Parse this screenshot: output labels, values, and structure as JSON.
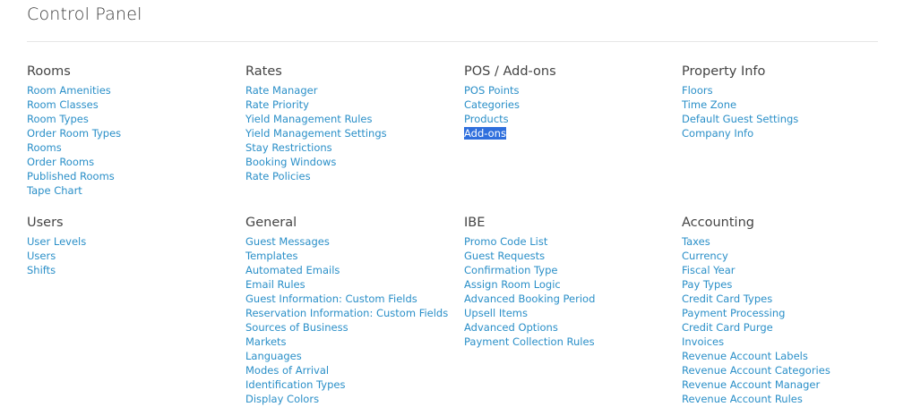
{
  "page": {
    "title": "Control Panel"
  },
  "sections": {
    "rooms": {
      "heading": "Rooms",
      "links": [
        "Room Amenities",
        "Room Classes",
        "Room Types",
        "Order Room Types",
        "Rooms",
        "Order Rooms",
        "Published Rooms",
        "Tape Chart"
      ]
    },
    "rates": {
      "heading": "Rates",
      "links": [
        "Rate Manager",
        "Rate Priority",
        "Yield Management Rules",
        "Yield Management Settings",
        "Stay Restrictions",
        "Booking Windows",
        "Rate Policies"
      ]
    },
    "pos": {
      "heading": "POS / Add-ons",
      "links": [
        "POS Points",
        "Categories",
        "Products",
        "Add-ons"
      ],
      "selected_index": 3
    },
    "property": {
      "heading": "Property Info",
      "links": [
        "Floors",
        "Time Zone",
        "Default Guest Settings",
        "Company Info"
      ]
    },
    "users": {
      "heading": "Users",
      "links": [
        "User Levels",
        "Users",
        "Shifts"
      ]
    },
    "general": {
      "heading": "General",
      "links": [
        "Guest Messages",
        "Templates",
        "Automated Emails",
        "Email Rules",
        "Guest Information: Custom Fields",
        "Reservation Information: Custom Fields",
        "Sources of Business",
        "Markets",
        "Languages",
        "Modes of Arrival",
        "Identification Types",
        "Display Colors"
      ]
    },
    "ibe": {
      "heading": "IBE",
      "links": [
        "Promo Code List",
        "Guest Requests",
        "Confirmation Type",
        "Assign Room Logic",
        "Advanced Booking Period",
        "Upsell Items",
        "Advanced Options",
        "Payment Collection Rules"
      ]
    },
    "accounting": {
      "heading": "Accounting",
      "links": [
        "Taxes",
        "Currency",
        "Fiscal Year",
        "Pay Types",
        "Credit Card Types",
        "Payment Processing",
        "Credit Card Purge",
        "Invoices",
        "Revenue Account Labels",
        "Revenue Account Categories",
        "Revenue Account Manager",
        "Revenue Account Rules"
      ]
    }
  },
  "colors": {
    "link": "#2a8fc8",
    "heading": "#444444",
    "selection_bg": "#2f6fdd",
    "selection_text": "#ffffff"
  }
}
